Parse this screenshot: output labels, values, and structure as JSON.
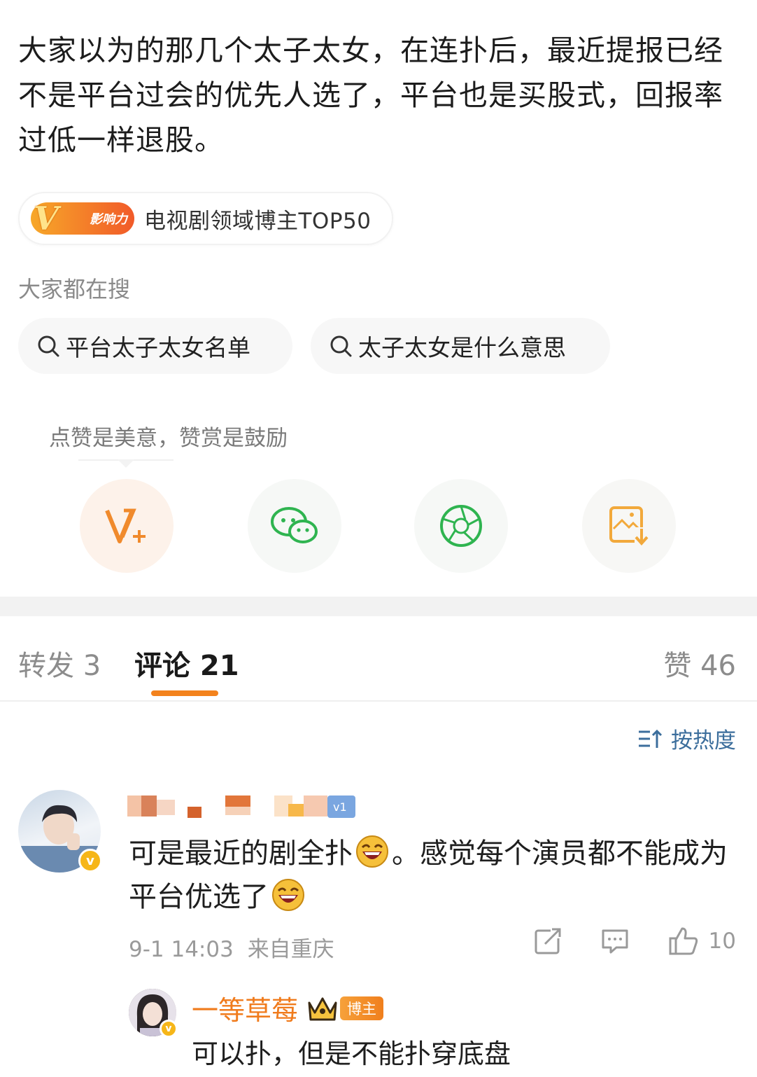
{
  "post": {
    "text": "大家以为的那几个太子太女，在连扑后，最近提报已经不是平台过会的优先人选了，平台也是买股式，回报率过低一样退股。"
  },
  "badge": {
    "logo_text": "影响力",
    "label": "电视剧领域博主TOP50"
  },
  "search": {
    "title": "大家都在搜",
    "items": [
      "平台太子太女名单",
      "太子太女是什么意思"
    ]
  },
  "reward": {
    "tip": "点赞是美意，赞赏是鼓励"
  },
  "tabs": {
    "repost": "转发 3",
    "comment": "评论 21",
    "like": "赞 46"
  },
  "sort": {
    "label": "按热度"
  },
  "comments": [
    {
      "text_before": "可是最近的剧全扑",
      "text_after": "。感觉每个演员都不能成为平台优选了",
      "time": "9-1 14:03",
      "location": "来自重庆",
      "likes": "10"
    }
  ],
  "reply": {
    "name": "一等草莓",
    "tag": "博主",
    "text": "可以扑，但是不能扑穿底盘"
  },
  "colors": {
    "accent": "#f3821d",
    "link": "#3c6e9c",
    "wechat": "#2fb450"
  }
}
